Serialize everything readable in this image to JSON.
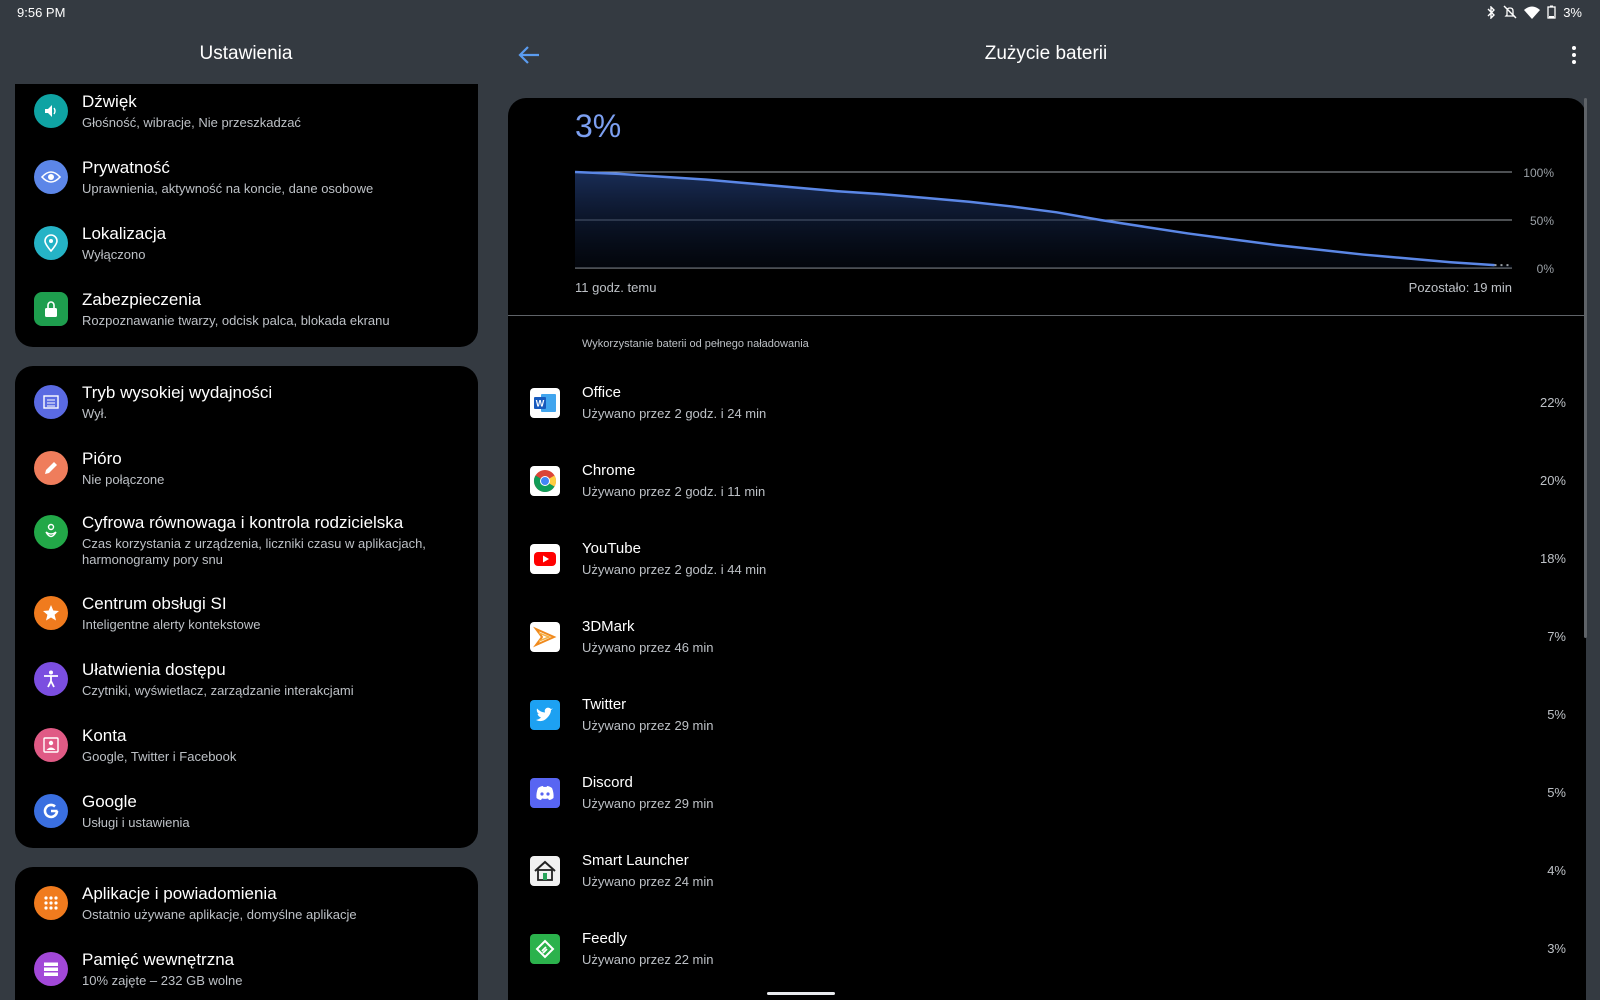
{
  "status_bar": {
    "time": "9:56 PM",
    "battery_text": "3%",
    "icons": [
      "bluetooth-icon",
      "mute-icon",
      "wifi-icon",
      "battery-icon"
    ]
  },
  "left_header": {
    "title": "Ustawienia"
  },
  "right_header": {
    "title": "Zużycie baterii",
    "back_icon": "arrow-back-icon",
    "more_icon": "more-vert-icon"
  },
  "settings": {
    "group1": [
      {
        "title": "Dźwięk",
        "subtitle": "Głośność, wibracje, Nie przeszkadzać",
        "icon": "volume-icon",
        "color": "#0fa3a3"
      },
      {
        "title": "Prywatność",
        "subtitle": "Uprawnienia, aktywność na koncie, dane osobowe",
        "icon": "privacy-eye-icon",
        "color": "#5c86e8"
      },
      {
        "title": "Lokalizacja",
        "subtitle": "Wyłączono",
        "icon": "location-pin-icon",
        "color": "#25b3c6"
      },
      {
        "title": "Zabezpieczenia",
        "subtitle": "Rozpoznawanie twarzy, odcisk palca, blokada ekranu",
        "icon": "lock-icon",
        "color": "#1e9e4e"
      }
    ],
    "group2": [
      {
        "title": "Tryb wysokiej wydajności",
        "subtitle": "Wył.",
        "icon": "performance-list-icon",
        "color": "#5a6ae2"
      },
      {
        "title": "Pióro",
        "subtitle": "Nie połączone",
        "icon": "pen-icon",
        "color": "#ef7d5c"
      },
      {
        "title": "Cyfrowa równowaga i kontrola rodzicielska",
        "subtitle": "Czas korzystania z urządzenia, liczniki czasu w aplikacjach, harmonogramy pory snu",
        "icon": "wellbeing-icon",
        "color": "#22a848"
      },
      {
        "title": "Centrum obsługi SI",
        "subtitle": "Inteligentne alerty kontekstowe",
        "icon": "star-icon",
        "color": "#f07b1e"
      },
      {
        "title": "Ułatwienia dostępu",
        "subtitle": "Czytniki, wyświetlacz, zarządzanie interakcjami",
        "icon": "accessibility-icon",
        "color": "#7b4ee0"
      },
      {
        "title": "Konta",
        "subtitle": "Google, Twitter i Facebook",
        "icon": "account-icon",
        "color": "#e05a85"
      },
      {
        "title": "Google",
        "subtitle": "Usługi i ustawienia",
        "icon": "google-g-icon",
        "color": "#3a6fe0"
      }
    ],
    "group3": [
      {
        "title": "Aplikacje i powiadomienia",
        "subtitle": "Ostatnio używane aplikacje, domyślne aplikacje",
        "icon": "apps-grid-icon",
        "color": "#f07b1e"
      },
      {
        "title": "Pamięć wewnętrzna",
        "subtitle": "10% zajęte – 232 GB wolne",
        "icon": "storage-icon",
        "color": "#a248d8"
      }
    ]
  },
  "battery": {
    "current_percent": "3%",
    "history_start_label": "11 godz. temu",
    "remaining_label": "Pozostało: 19 min",
    "section_header": "Wykorzystanie baterii od pełnego naładowania"
  },
  "chart_data": {
    "type": "area",
    "title": "",
    "xlabel": "",
    "ylabel": "",
    "y_ticks": [
      "100%",
      "50%",
      "0%"
    ],
    "ylim": [
      0,
      100
    ],
    "x": [
      0,
      0.5,
      1,
      1.5,
      2,
      2.5,
      3,
      3.5,
      4,
      4.5,
      5,
      5.5,
      6,
      6.5,
      7,
      7.5,
      8,
      8.5,
      9,
      9.5,
      10,
      10.5,
      10.7
    ],
    "series": [
      {
        "values": [
          100,
          98,
          95,
          92,
          88,
          84,
          80,
          77,
          73,
          69,
          64,
          58,
          50,
          43,
          36,
          30,
          24,
          19,
          14,
          10,
          6,
          3,
          3
        ]
      }
    ],
    "colors": {
      "line": "#5b87e6",
      "grid": "#9aa0a6"
    }
  },
  "apps": [
    {
      "name": "Office",
      "usage": "Używano przez 2 godz. i 24 min",
      "percent": "22%",
      "icon": "office-word-icon"
    },
    {
      "name": "Chrome",
      "usage": "Używano przez 2 godz. i 11 min",
      "percent": "20%",
      "icon": "chrome-icon"
    },
    {
      "name": "YouTube",
      "usage": "Używano przez 2 godz. i 44 min",
      "percent": "18%",
      "icon": "youtube-icon"
    },
    {
      "name": "3DMark",
      "usage": "Używano przez 46 min",
      "percent": "7%",
      "icon": "3dmark-icon"
    },
    {
      "name": "Twitter",
      "usage": "Używano przez 29 min",
      "percent": "5%",
      "icon": "twitter-bird-icon"
    },
    {
      "name": "Discord",
      "usage": "Używano przez 29 min",
      "percent": "5%",
      "icon": "discord-icon"
    },
    {
      "name": "Smart Launcher",
      "usage": "Używano przez 24 min",
      "percent": "4%",
      "icon": "smart-launcher-home-icon"
    },
    {
      "name": "Feedly",
      "usage": "Używano przez 22 min",
      "percent": "3%",
      "icon": "feedly-icon"
    }
  ]
}
